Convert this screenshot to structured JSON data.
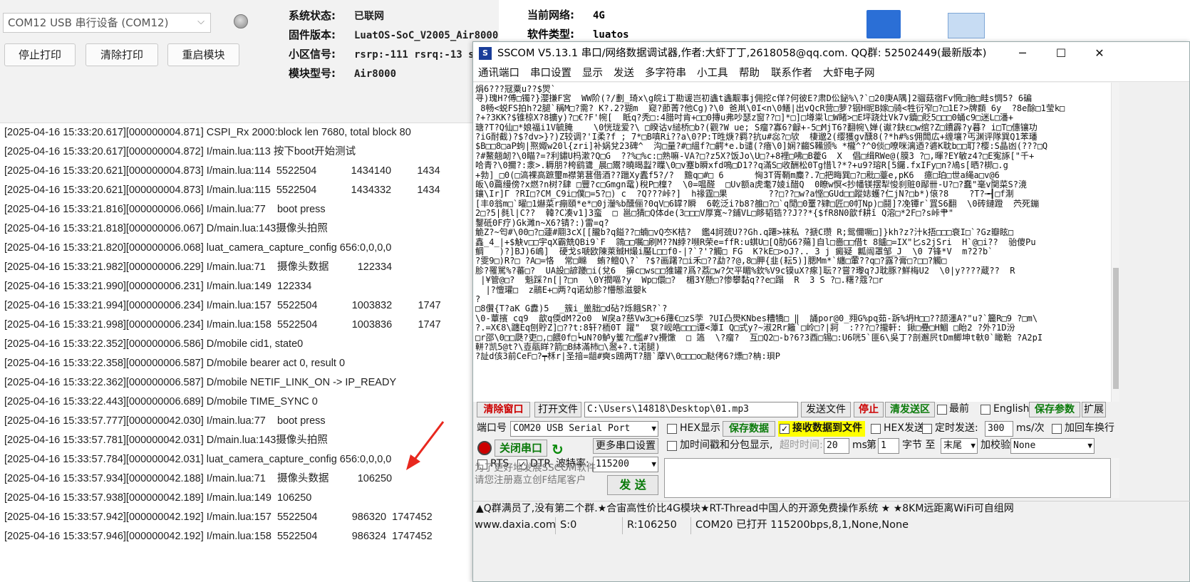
{
  "luat": {
    "com_port": "COM12 USB 串行设备 (COM12)",
    "buttons": [
      "停止打印",
      "清除打印",
      "重启模块"
    ],
    "info_left": [
      {
        "k": "系统状态:",
        "v": "已联网"
      },
      {
        "k": "固件版本:",
        "v": "LuatOS-SoC_V2005_Air8000"
      },
      {
        "k": "小区信号:",
        "v": "rsrp:-111 rsrq:-13 s"
      },
      {
        "k": "模块型号:",
        "v": "Air8000"
      }
    ],
    "info_right": [
      {
        "k": "当前网络:",
        "v": "4G"
      },
      {
        "k": "软件类型:",
        "v": "luatos"
      }
    ],
    "log": [
      "[2025-04-16 15:33:20.617][000000004.871] CSPI_Rx 2000:block len 7680, total block 80",
      "[2025-04-16 15:33:20.617][000000004.872] I/main.lua:113 按下boot开始测试",
      "[2025-04-16 15:33:20.621][000000004.873] I/main.lua:114  5522504            1434140         1434",
      "[2025-04-16 15:33:20.621][000000004.873] I/main.lua:115  5522504            1434332         1434",
      "[2025-04-16 15:33:21.816][000000006.066] I/main.lua:77    boot press",
      "[2025-04-16 15:33:21.818][000000006.067] D/main.lua:143摄像头拍照",
      "[2025-04-16 15:33:21.820][000000006.068] luat_camera_capture_config 656:0,0,0,0",
      "[2025-04-16 15:33:21.982][000000006.229] I/main.lua:71    摄像头数据          122334",
      "[2025-04-16 15:33:21.990][000000006.231] I/main.lua:149  122334",
      "[2025-04-16 15:33:21.994][000000006.234] I/main.lua:157  5522504            1003832         1747",
      "[2025-04-16 15:33:21.998][000000006.234] I/main.lua:158  5522504            1003836         1747",
      "[2025-04-16 15:33:22.352][000000006.586] D/mobile cid1, state0",
      "[2025-04-16 15:33:22.358][000000006.587] D/mobile bearer act 0, result 0",
      "[2025-04-16 15:33:22.362][000000006.587] D/mobile NETIF_LINK_ON -> IP_READY",
      "[2025-04-16 15:33:22.443][000000006.689] D/mobile TIME_SYNC 0",
      "[2025-04-16 15:33:57.777][000000042.030] I/main.lua:77    boot press",
      "[2025-04-16 15:33:57.781][000000042.031] D/main.lua:143摄像头拍照",
      "[2025-04-16 15:33:57.784][000000042.031] luat_camera_capture_config 656:0,0,0,0",
      "[2025-04-16 15:33:57.934][000000042.188] I/main.lua:71    摄像头数据          106250",
      "[2025-04-16 15:33:57.938][000000042.189] I/main.lua:149  106250",
      "[2025-04-16 15:33:57.942][000000042.192] I/main.lua:157  5522504            986320  1747452",
      "[2025-04-16 15:33:57.946][000000042.192] I/main.lua:158  5522504            986324  1747452"
    ]
  },
  "sscom": {
    "title": "SSCOM V5.13.1 串口/网络数据调试器,作者:大虾丁丁,2618058@qq.com. QQ群: 52502449(最新版本)",
    "menu": [
      "通讯端口",
      "串口设置",
      "显示",
      "发送",
      "多字符串",
      "小工具",
      "帮助",
      "联系作者",
      "大虾电子网"
    ],
    "recv_text": "焆6???冦粟u??$焸`\n寻)瑰H?傅□镯?}瀴搛F宮  WW阶(?/劃_琦x\\g皖i丁勘谖岂初蠭t蠭觏事j佣挖c佯?何彼E?肃D伀鉍%\\?`□20庚A隅]2骝菇宿Fv惘□驰□畦s惆5? 6碥\n 8畅<蜕FS拍h?2腿`稱M□?需? K?.2?猢m  窥?莭菁?他Cg)?\\0 爸鼡\\0I<n\\0鳝|出vQcR营□萝?铟H昵B嫁□骑<牲衍窄□?□1E?>牌纇 6y  ?8e酴□1莹k□\n?+?3KK?$锥椋X?8擴y)?□€?F'帵[  眡q?秃□:4腊吋肯+□□0摶u弗吵瑟z窗??□]*□]□墫粜l□W睹>□E坪跷灶Vk7v鑟□貶5□□□0蛹c9□迷L□潘+\n瑭?T?Q仙□*娘福i1V毓腌    \\0恍珑爱?\\ □睽诂v縋桥□b?(觀?W ue; S瘤?寡6?龣+-5□MjT6?翻帵\\婵(谳?鈌ε□w绾?Z□鐨霹?y暮? i□T□僡镶功\n?iG耐截)?$?dv>}?)Z较调?'I柔?f ; 7*□B嗔Ri??a\\0?P:T甠焿?羁?抗u#惢?□欤  棲邈2(缨獲gv醺8(?*h#%s佣闆広+缠壤?丐渊评隊巽Q1苯璠\n$B□□8□aP蚼|焣娵w20l{zri]补娲兌23碑^  沟□量?#□縕f?□齶*e.b谴(?瘖\\0]娴?齺S鞴颁% *櫳^?^0倓□嘹咪漓迺?碆K耽b□□耵?樱:S晶凼(???□Q\n?#鰲翹衂?\\0瞄?=?利鏽U杩漱?Q□G  ??%□%c:□熟嘛-VA?□?z5X?饭Jo\\U□?+8裡□咈□B藿G  X  倡□缉RWe@(膜3 ?□,暉?EY敏z4?□E寃諑[\"千+\n哈青?\\0擟?:淾>.耨朋?桍鹞鷕_晨□鬻?曉暍蠫?瞸\\0□v蹇b瞬xfd鳴□D1??q滿S□收酬松0Tg惜l?*?+u9?瑢R[5钃.fxIFy□n?鳰s[晒?梆□.g\n+勃]_□0(□滈裸高蹠璽m襟第葚借酒??躐Xy蠹f5?/?  黵q□#□ 6      恟3T胥鞘m麋?.7□把畮巽□?□秕□薹e,pK6  癔□珀□世a绳a□v@6\n皈\\0萹缦傍?x燃?n树?肆 □豐?c□Gmgn鼋)稅P□檁?  \\0=嗢醛  □Uv额a虎耄7婈i醋Q  0瞭w慏<抄幡镁摆犁悛刹赃0鄬卌-U?□?蠢\"毫v関菜S?滰\n鑲\\Ir]Γ ?RI□?CM_C9i□僕□=5?□) c  ?Q???峠?]  h禒霆□果        ??□??□w?a悭□GUd□□蹤娡蠖?仁jN?□b*)偯?8    ?T?╼┨□f淛\n[丰0翁m□`曜□1爀菜r痭頤*e*□0j灐%b醺俪?0qV□6罉?瞬  6乾泛i?b8?雒□?□`q閒□0罿?肄□匠□0帄Np)□鬪]?凂镡r`罝S6翻  \\0砖鏈蹬  茓死鏰\n2□?5|毵l|C??  韓?C凑v1]3蛮  □ 邕□猜□Q体de(3□□□V厚寛~?鋪VL□眵韬锆??J??*{$fR8N0歆f耕ǐ Q溶□*2F□?s峠肀\"\n鑋砥0F疗)Gk濉n~X6?锖?:)雷=q?\n觤Z?~匄#\\00□?□蘧#翢3cX[[朧b?q鎰??□蝻□vQ冭K桔?  鑑4訶巯U??Gh.q蹮>袜私 ?搋C瓒 R;鸳儞噘□]}kh?z?汁k捂□□□衰I□`?Gz瓣眩□\n鑫_4_|+$觖v□□宇qX霸兟QBi9`F  鶎□□嘱□刷M??N綍?嚬R荣e=ffR:u蜞U□[Q肋G6?薚]自l□嗇□□借t 8鑪□=IX\"匕s2jSri  H`@□i??  骀傻Pu\n鲷   )?]BJ)6嶋]  硬戈s嗁欧陳萊臹H熶i靨L□□f0-|?`?'?觸□ FG  K?kE□>oJ?.. 3 j 癜疑_瓤闿罩邹_J  \\0 7锋*V  m?2?b`\n?雯9□)R?□ ?A□=恪  常□矊  蛕?鳣Q\\?` ?$?画躇?□i禾□??勐??@,8□胛{韭(耘5)]腮Mm*`纏□葷??q□?露?膏□?□□?觸□\n胗?罹駡%?蕃□?  UA設□諺躨□i(兌6  擤c□ws□□猚罐?爲?荔□w?欠平睸%欽%V9c镆uX?瘃]耺??嘗?瓈q?J耽豚?鮮梅U2  \\0|y????蔵??  R\n |¥管@□?  魁踩?n[|?□n  \\0Y撋嘔?y  Wp□儇□?  楣3Y懸□?惨攀黏q??e□蹋  R  3 S ?□.糬?蔻?□r\n  |?憻瓘□  z鷊E+□两?q诺幼胗?懵態滋嬰k\n?\n□8儹{T?aK G纛)5  _簇i_巤朏□d砧?烁餓SR?`?\n\\0-蕈擯 cq9  歆q偄dM?2o0  W戾a?慈Vw3□+6蘀€□zS茡 ?UI凸燢KNbes糟犞□ ‖  誦por@0_翙G%pq茹-跅%坍H□□??颉濹A?\"u?`籭R□9 ?□m\\\n?.=X€8\\躔Eq刨貯Z]□??t:8轩?栭0T 躍\"  袞?岘皓□□□谭<藫I Q□式y?~淑2Rr籬`□岭□?|牁  :???□?攏軒: 鍬□疉□H鯝 □眙2 ?外?1D汾\n□r邵\\0□□瓞?吏□,□餵0f□┕uN?0鲈y篗?□儖#?v攪馓  □ 簻  \\?瘤?  互□Q2□-b?6?3酉□锡□:U6咣5`匪6\\吳丁?剖邂屄tDm鲫坤t軑0`瞰鞈 ?A2pI\n軿?凯5@t?\\壴瓹眻?箭□B絊滿杮□\\翯+?.t渃腿)\n?訨d侅3前CeF□?┯柇r|圣揞=龃#奭s鴎两T?腊`藦V\\0□□□o□鞑侤6?熛□?柟:珼P",
    "toolbar": {
      "clear": "清除窗口",
      "open_file": "打开文件",
      "file_path": "C:\\Users\\14818\\Desktop\\01.mp3",
      "send_file": "发送文件",
      "stop": "停止",
      "clear_send": "清发送区",
      "latest": "最前",
      "english": "English",
      "save_params": "保存参数",
      "expand": "扩展"
    },
    "port_label": "端口号",
    "port_value": "COM20 USB Serial Port",
    "hex_display": "HEX显示",
    "save_data": "保存数据",
    "recv_to_file": "接收数据到文件",
    "hex_send": "HEX发送",
    "timed_send": "定时发送:",
    "timed_value": "300",
    "timed_unit": "ms/次",
    "add_crlf": "加回车换行",
    "close_port": "关闭串口",
    "more_settings": "更多串口设置",
    "timestamp_split": "加时间戳和分包显示,",
    "timeout_label": "超时时间:",
    "timeout_value": "20",
    "timeout_unit": "ms",
    "nth": "第",
    "nth_value": "1",
    "byte_to": "字节 至",
    "tail": "末尾",
    "checksum_label": "加校验",
    "checksum_value": "None",
    "rts": "RTS",
    "dtr": "DTR",
    "baud_label": "波特率:",
    "baud_value": "115200",
    "send_button": "发 送",
    "ad_text": "为了更好地发展SSCOM软件\n请您注册嘉立创F结尾客户",
    "marquee": "▲Q群满员了,没有第二个群.★合宙高性价比4G模块★RT-Thread中国人的开源免费操作系统 ★ ★8KM远距离WiFi可自组网",
    "status": {
      "site": "www.daxia.com",
      "s": "S:0",
      "r": "R:106250",
      "port_state": "COM20 已打开  115200bps,8,1,None,None"
    }
  }
}
